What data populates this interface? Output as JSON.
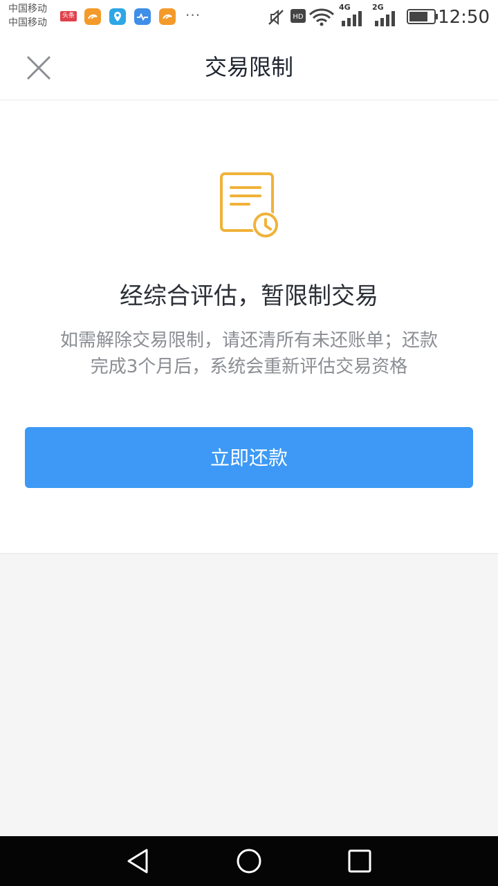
{
  "status_bar": {
    "carriers": [
      "中国移动",
      "中国移动"
    ],
    "notification_badge": "头条",
    "more": "···",
    "network_hd": "HD",
    "network_4g": "4G",
    "network_2g": "2G",
    "time": "12:50"
  },
  "nav": {
    "title": "交易限制",
    "close_icon": "close-icon"
  },
  "main": {
    "icon": "document-clock-icon",
    "headline": "经综合评估，暂限制交易",
    "description": "如需解除交易限制，请还清所有未还账单；还款完成3个月后，系统会重新评估交易资格",
    "repay_button": "立即还款"
  },
  "colors": {
    "accent": "#3d99f5",
    "icon_orange": "#f0b23a",
    "page_bg": "#f4f5f4",
    "text_primary": "#2b2f36",
    "text_secondary": "#8a8d92"
  },
  "system_nav": {
    "back": "back-triangle-icon",
    "home": "home-circle-icon",
    "recents": "recents-square-icon"
  }
}
